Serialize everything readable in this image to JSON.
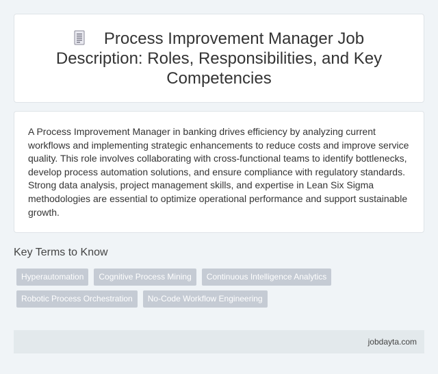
{
  "header": {
    "icon": "document-icon",
    "title": "Process Improvement Manager Job Description: Roles, Responsibilities, and Key Competencies"
  },
  "summary": {
    "text": "A Process Improvement Manager in banking drives efficiency by analyzing current workflows and implementing strategic enhancements to reduce costs and improve service quality. This role involves collaborating with cross-functional teams to identify bottlenecks, develop process automation solutions, and ensure compliance with regulatory standards. Strong data analysis, project management skills, and expertise in Lean Six Sigma methodologies are essential to optimize operational performance and support sustainable growth."
  },
  "key_terms": {
    "heading": "Key Terms to Know",
    "rows": [
      [
        "Hyperautomation",
        "Cognitive Process Mining",
        "Continuous Intelligence Analytics"
      ],
      [
        "Robotic Process Orchestration",
        "No-Code Workflow Engineering"
      ]
    ]
  },
  "footer": {
    "site": "jobdayta.com"
  },
  "colors": {
    "background": "#f0f4f7",
    "card": "#ffffff",
    "tag": "#c5cbd4",
    "footer": "#e3e9ec"
  }
}
